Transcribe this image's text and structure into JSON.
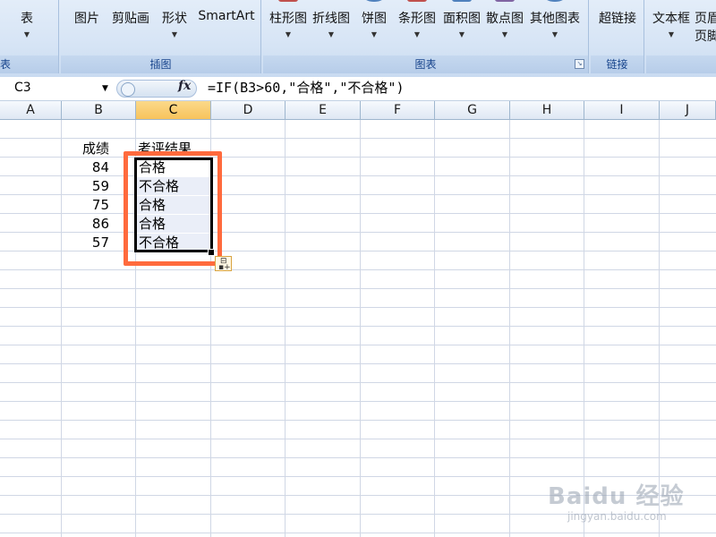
{
  "ribbon": {
    "groups": [
      {
        "label": "表"
      },
      {
        "label": "插图"
      },
      {
        "label": "图表"
      },
      {
        "label": "链接"
      }
    ],
    "buttons": {
      "table": "表",
      "picture": "图片",
      "clipart": "剪贴画",
      "shapes": "形状",
      "smartart": "SmartArt",
      "column_chart": "柱形图",
      "line_chart": "折线图",
      "pie_chart": "饼图",
      "bar_chart": "条形图",
      "area_chart": "面积图",
      "scatter_chart": "散点图",
      "other_charts": "其他图表",
      "hyperlink": "超链接",
      "textbox": "文本框",
      "header_footer_1": "页眉",
      "header_footer_2": "页脚"
    }
  },
  "formula_bar": {
    "name_box": "C3",
    "fx_label": "fx",
    "formula": "=IF(B3>60,\"合格\",\"不合格\")"
  },
  "columns": [
    "A",
    "B",
    "C",
    "D",
    "E",
    "F",
    "G",
    "H",
    "I",
    "J"
  ],
  "active_column": "C",
  "sheet": {
    "header_b": "成绩",
    "header_c": "考评结果",
    "scores": [
      "84",
      "59",
      "75",
      "86",
      "57"
    ],
    "results": [
      "合格",
      "不合格",
      "合格",
      "合格",
      "不合格"
    ]
  },
  "watermark": {
    "main": "Baidu 经验",
    "sub": "jingyan.baidu.com"
  },
  "colors": {
    "highlight": "#ff6a3d",
    "ribbon_label": "#15428b",
    "active_column": "#f7c35c"
  }
}
